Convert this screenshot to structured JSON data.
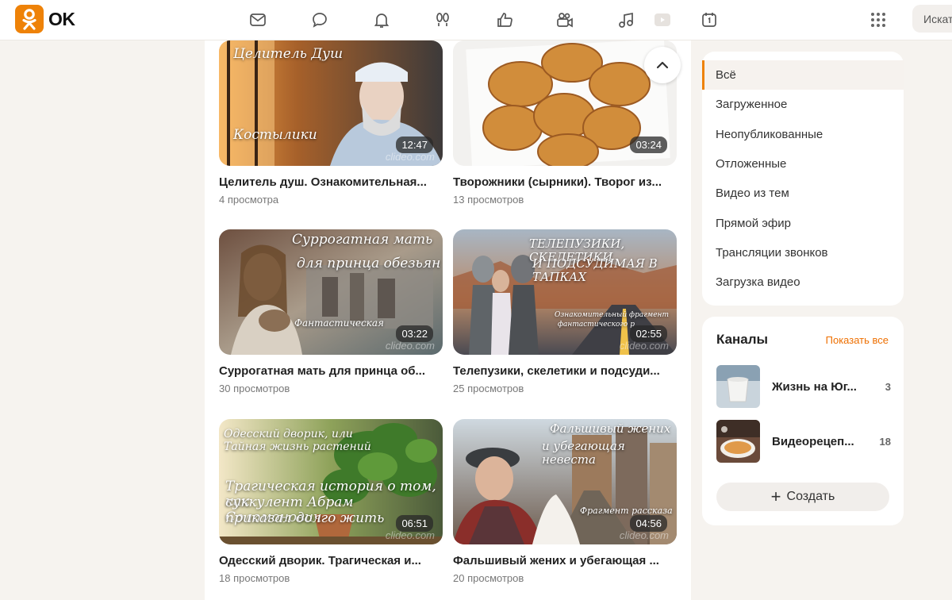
{
  "header": {
    "logo_text": "OK",
    "search_placeholder": "Искать",
    "nav_icons": [
      "mail-icon",
      "chat-icon",
      "bell-icon",
      "guests-icon",
      "likes-icon",
      "video-camera-icon",
      "music-icon",
      "video-play-icon",
      "calendar-icon",
      "apps-grid-icon"
    ],
    "accent_color": "#ee8208"
  },
  "videos": [
    {
      "title": "Целитель душ. Ознакомительная...",
      "views": "4 просмотра",
      "duration": "12:47",
      "overlay": [
        "Целитель Душ",
        "Костылики"
      ],
      "watermark": "clideo.com"
    },
    {
      "title": "Творожники (сырники). Творог из...",
      "views": "13 просмотров",
      "duration": "03:24",
      "overlay": [],
      "watermark": ""
    },
    {
      "title": "Суррогатная мать для принца об...",
      "views": "30 просмотров",
      "duration": "03:22",
      "overlay": [
        "Суррогатная мать",
        "для принца обезьян",
        "Фантастическая"
      ],
      "watermark": "clideo.com"
    },
    {
      "title": "Телепузики, скелетики и подсуди...",
      "views": "25 просмотров",
      "duration": "02:55",
      "overlay": [
        "ТЕЛЕПУЗИКИ, СКЕЛЕТИКИ",
        "И ПОДСУДИМАЯ В ТАПКАХ",
        "Ознакомительный фрагмент",
        "фантастического р"
      ],
      "watermark": "clideo.com"
    },
    {
      "title": "Одесский дворик. Трагическая и...",
      "views": "18 просмотров",
      "duration": "06:51",
      "overlay": [
        "Одесский дворик, или",
        "Тайная жизнь растений",
        "Трагическая история о том, как",
        "суккулент Абрам Соломонович",
        "приказал долго жить"
      ],
      "watermark": "clideo.com"
    },
    {
      "title": "Фальшивый жених и убегающая ...",
      "views": "20 просмотров",
      "duration": "04:56",
      "overlay": [
        "Фальшивый жених",
        "и убегающая невеста",
        "Фрагмент рассказа"
      ],
      "watermark": "clideo.com"
    }
  ],
  "sidebar": {
    "menu": [
      {
        "label": "Всё",
        "active": true
      },
      {
        "label": "Загруженное",
        "active": false
      },
      {
        "label": "Неопубликованные",
        "active": false
      },
      {
        "label": "Отложенные",
        "active": false
      },
      {
        "label": "Видео из тем",
        "active": false
      },
      {
        "label": "Прямой эфир",
        "active": false
      },
      {
        "label": "Трансляции звонков",
        "active": false
      },
      {
        "label": "Загрузка видео",
        "active": false
      }
    ],
    "channels": {
      "title": "Каналы",
      "show_all": "Показать все",
      "items": [
        {
          "name": "Жизнь на Юг...",
          "count": "3"
        },
        {
          "name": "Видеорецеп...",
          "count": "18"
        }
      ],
      "create_label": "Создать"
    }
  }
}
